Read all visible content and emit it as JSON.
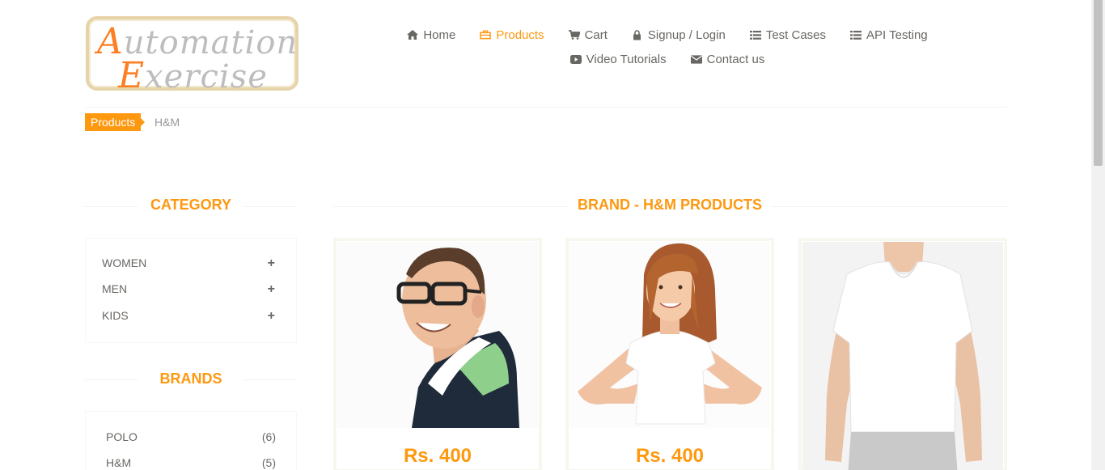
{
  "logo": {
    "line1_cap": "A",
    "line1_rest": "utomation",
    "line2_cap": "E",
    "line2_rest": "xercise"
  },
  "nav": {
    "row1": [
      {
        "label": "Home",
        "icon": "home-icon"
      },
      {
        "label": "Products",
        "icon": "products-icon",
        "active": true
      },
      {
        "label": "Cart",
        "icon": "cart-icon"
      },
      {
        "label": "Signup / Login",
        "icon": "lock-icon"
      },
      {
        "label": "Test Cases",
        "icon": "list-icon"
      },
      {
        "label": "API Testing",
        "icon": "list-icon"
      }
    ],
    "row2": [
      {
        "label": "Video Tutorials",
        "icon": "youtube-icon"
      },
      {
        "label": "Contact us",
        "icon": "envelope-icon"
      }
    ]
  },
  "breadcrumb": {
    "active": "Products",
    "current": "H&M"
  },
  "category": {
    "title": "CATEGORY",
    "items": [
      {
        "label": "WOMEN",
        "toggle": "+"
      },
      {
        "label": "MEN",
        "toggle": "+"
      },
      {
        "label": "KIDS",
        "toggle": "+"
      }
    ]
  },
  "brands": {
    "title": "BRANDS",
    "items": [
      {
        "label": "POLO",
        "count": "(6)"
      },
      {
        "label": "H&M",
        "count": "(5)"
      }
    ]
  },
  "products_section": {
    "title": "BRAND - H&M PRODUCTS"
  },
  "products": [
    {
      "price": "Rs. 400",
      "image": "man-with-glasses-polo-shirt"
    },
    {
      "price": "Rs. 400",
      "image": "girl-white-tshirt"
    },
    {
      "price": "",
      "image": "man-white-vneck-tshirt"
    }
  ],
  "colors": {
    "accent": "#fe980f",
    "text": "#696763"
  }
}
